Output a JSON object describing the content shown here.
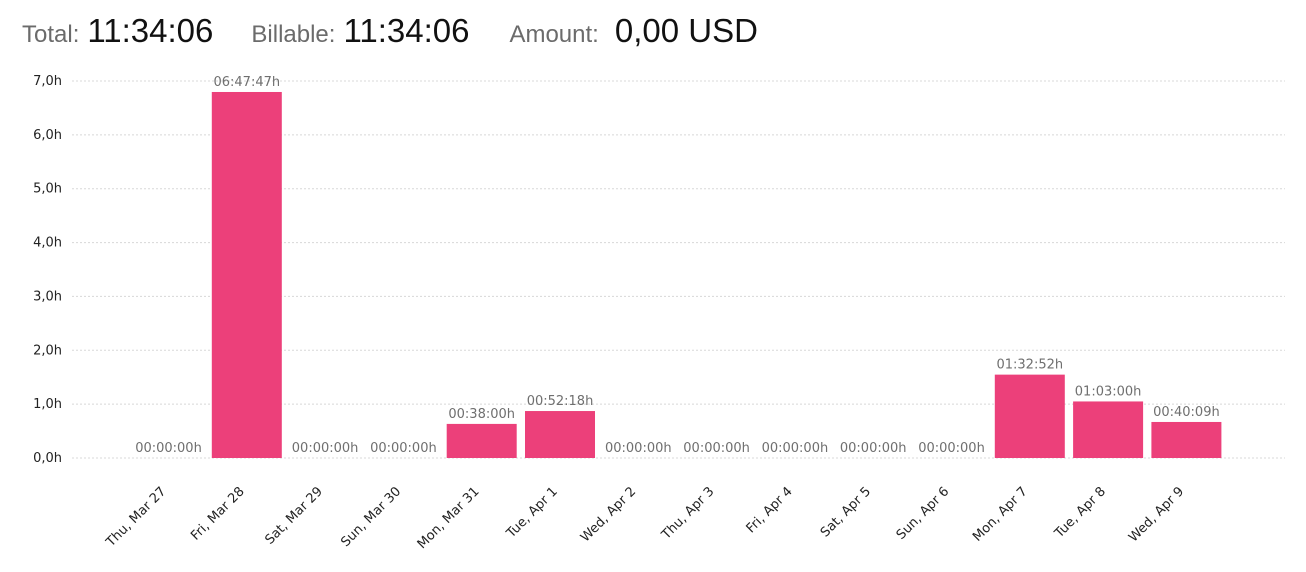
{
  "summary": {
    "total_label": "Total:",
    "total_value": "11:34:06",
    "billable_label": "Billable:",
    "billable_value": "11:34:06",
    "amount_label": "Amount:",
    "amount_value": "0,00 USD"
  },
  "chart_data": {
    "type": "bar",
    "categories": [
      "Thu, Mar 27",
      "Fri, Mar 28",
      "Sat, Mar 29",
      "Sun, Mar 30",
      "Mon, Mar 31",
      "Tue, Apr 1",
      "Wed, Apr 2",
      "Thu, Apr 3",
      "Fri, Apr 4",
      "Sat, Apr 5",
      "Sun, Apr 6",
      "Mon, Apr 7",
      "Tue, Apr 8",
      "Wed, Apr 9"
    ],
    "values": [
      0,
      6.796,
      0,
      0,
      0.633,
      0.872,
      0,
      0,
      0,
      0,
      0,
      1.548,
      1.05,
      0.669
    ],
    "data_labels": [
      "00:00:00h",
      "06:47:47h",
      "00:00:00h",
      "00:00:00h",
      "00:38:00h",
      "00:52:18h",
      "00:00:00h",
      "00:00:00h",
      "00:00:00h",
      "00:00:00h",
      "00:00:00h",
      "01:32:52h",
      "01:03:00h",
      "00:40:09h"
    ],
    "y_ticks": [
      "0,0h",
      "1,0h",
      "2,0h",
      "3,0h",
      "4,0h",
      "5,0h",
      "6,0h",
      "7,0h"
    ],
    "ylim": [
      0,
      7
    ],
    "grid": true,
    "bar_color": "#ec407a"
  }
}
